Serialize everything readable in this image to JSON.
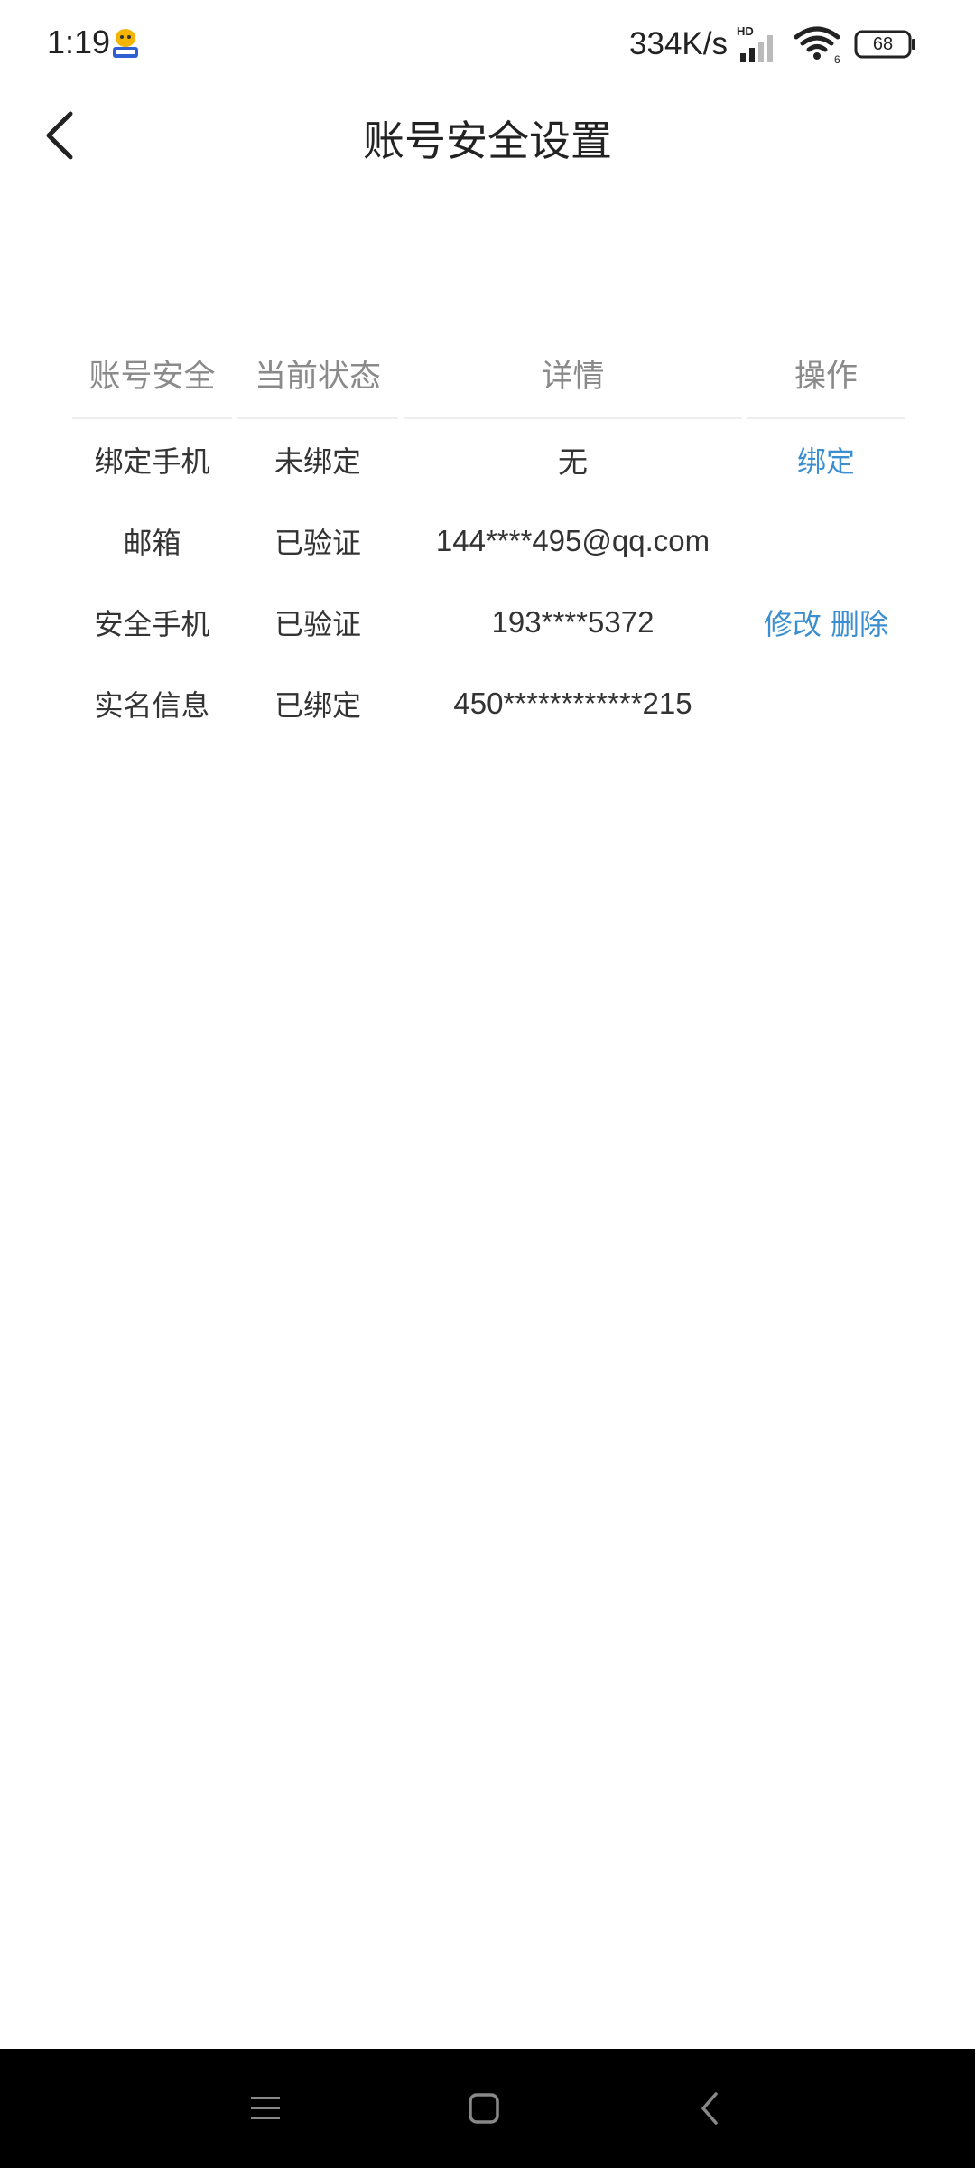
{
  "status_bar": {
    "time": "1:19",
    "net_speed": "334K/s",
    "network_badge": "HD",
    "sim_slot": "6",
    "battery_level": "68"
  },
  "header": {
    "title": "账号安全设置"
  },
  "table": {
    "headers": [
      "账号安全",
      "当前状态",
      "详情",
      "操作"
    ],
    "rows": [
      {
        "item": "绑定手机",
        "status": "未绑定",
        "detail": "无",
        "actions": [
          "绑定"
        ]
      },
      {
        "item": "邮箱",
        "status": "已验证",
        "detail": "144****495@qq.com",
        "actions": []
      },
      {
        "item": "安全手机",
        "status": "已验证",
        "detail": "193****5372",
        "actions": [
          "修改",
          "删除"
        ]
      },
      {
        "item": "实名信息",
        "status": "已绑定",
        "detail": "450************215",
        "actions": []
      }
    ]
  },
  "colors": {
    "link": "#3b8fd0",
    "header_text": "#8a8a8a",
    "body_text": "#333333",
    "nav_bar_bg": "#000000"
  },
  "icons": {
    "back": "chevron-left-icon",
    "signal": "signal-bars-icon",
    "wifi": "wifi-icon",
    "battery": "battery-icon",
    "menu": "menu-icon",
    "home": "home-square-icon",
    "system_back": "system-back-icon"
  }
}
